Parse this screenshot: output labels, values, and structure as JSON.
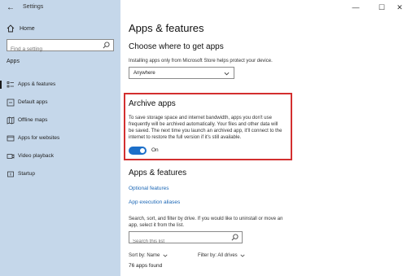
{
  "window": {
    "title": "Settings",
    "back_glyph": "←",
    "min_glyph": "—",
    "max_glyph": "☐",
    "close_glyph": "✕"
  },
  "sidebar": {
    "home_label": "Home",
    "search_placeholder": "Find a setting",
    "section_label": "Apps",
    "items": [
      {
        "label": "Apps & features",
        "icon": "apps-list-icon",
        "active": true
      },
      {
        "label": "Default apps",
        "icon": "default-apps-icon",
        "active": false
      },
      {
        "label": "Offline maps",
        "icon": "map-icon",
        "active": false
      },
      {
        "label": "Apps for websites",
        "icon": "website-apps-icon",
        "active": false
      },
      {
        "label": "Video playback",
        "icon": "video-icon",
        "active": false
      },
      {
        "label": "Startup",
        "icon": "startup-icon",
        "active": false
      }
    ]
  },
  "main": {
    "page_title": "Apps & features",
    "choose_heading": "Choose where to get apps",
    "choose_desc": "Installing apps only from Microsoft Store helps protect your device.",
    "choose_value": "Anywhere",
    "archive_heading": "Archive apps",
    "archive_desc_1": "To save storage space and internet bandwidth, apps you don't use",
    "archive_desc_2": "frequently will be archived automatically. Your files and other data will",
    "archive_desc_3": "be saved. The next time you launch an archived app, it'll connect to the",
    "archive_desc_4": "internet to restore the full version if it's still available.",
    "toggle_state": "On",
    "features_heading": "Apps & features",
    "link_optional": "Optional features",
    "link_aliases": "App execution aliases",
    "search_desc_1": "Search, sort, and filter by drive. If you would like to uninstall or move an",
    "search_desc_2": "app, select it from the list.",
    "search_placeholder": "Search this list",
    "sort_label": "Sort by: Name",
    "filter_label": "Filter by: All drives",
    "apps_found": "76 apps found"
  },
  "colors": {
    "sidebar_bg": "#c5d7ea",
    "accent": "#1c6fc9",
    "highlight": "#d32f2f"
  }
}
